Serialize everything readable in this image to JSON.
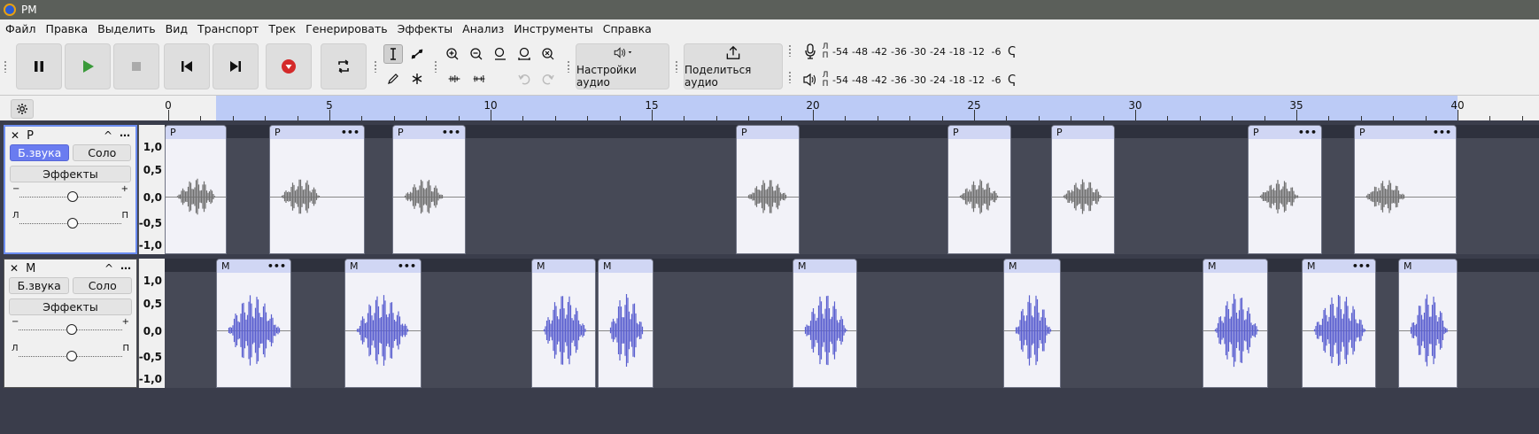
{
  "window": {
    "title": "PM"
  },
  "menu": [
    "Файл",
    "Правка",
    "Выделить",
    "Вид",
    "Транспорт",
    "Трек",
    "Генерировать",
    "Эффекты",
    "Анализ",
    "Инструменты",
    "Справка"
  ],
  "toolbar": {
    "pause": "pause-icon",
    "play": "play-icon",
    "stop": "stop-icon",
    "skip_start": "skip-start-icon",
    "skip_end": "skip-end-icon",
    "record": "record-icon",
    "loop": "loop-icon",
    "audio_settings_label": "Настройки аудио",
    "share_audio_label": "Поделиться аудио"
  },
  "meters": {
    "record_l": "Л",
    "record_r": "П",
    "play_l": "Л",
    "play_r": "П",
    "scale": [
      "-54",
      "-48",
      "-42",
      "-36",
      "-30",
      "-24",
      "-18",
      "-12",
      "-6"
    ]
  },
  "ruler": {
    "labels": [
      "0",
      "5",
      "10",
      "15",
      "20",
      "25",
      "30",
      "35",
      "40"
    ]
  },
  "tracks": [
    {
      "name": "Р",
      "mute": "Б.звука",
      "solo": "Соло",
      "effects": "Эффекты",
      "gain_minus": "−",
      "gain_plus": "+",
      "pan_l": "Л",
      "pan_r": "П",
      "scale": [
        "1,0",
        "0,5",
        "0,0",
        "-0,5",
        "-1,0"
      ],
      "clip_label": "Р",
      "wave_color": "#707070"
    },
    {
      "name": "М",
      "mute": "Б.звука",
      "solo": "Соло",
      "effects": "Эффекты",
      "gain_minus": "−",
      "gain_plus": "+",
      "pan_l": "Л",
      "pan_r": "П",
      "scale": [
        "1,0",
        "0,5",
        "0,0",
        "-0,5",
        "-1,0"
      ],
      "clip_label": "М",
      "wave_color": "#5a5fcf"
    }
  ],
  "colors": {
    "selected_region": "#bccbf6",
    "mute_active": "#6a7cf0",
    "track_bg": "#464956",
    "clip_bg": "#f2f2f8"
  }
}
